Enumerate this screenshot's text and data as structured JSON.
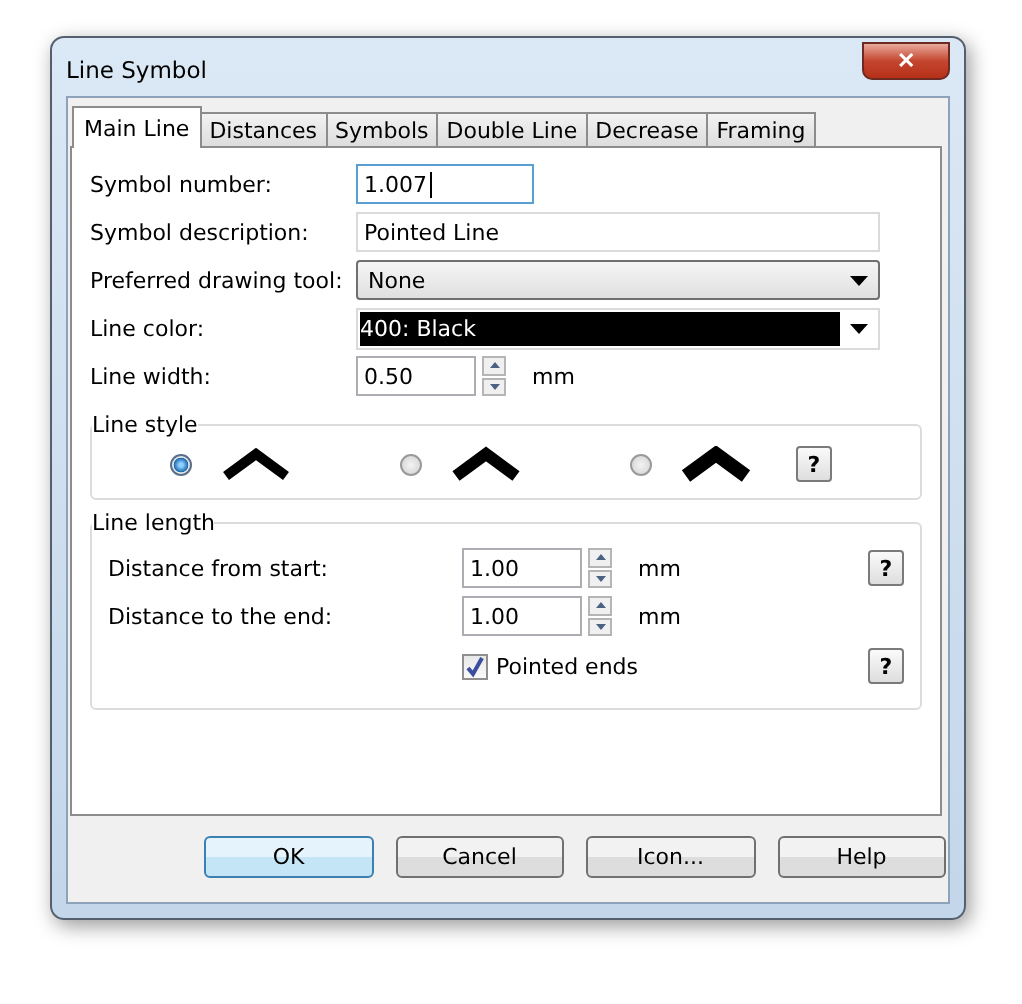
{
  "window": {
    "title": "Line Symbol",
    "close": "✕"
  },
  "tabs": [
    {
      "label": "Main Line",
      "selected": true
    },
    {
      "label": "Distances",
      "selected": false
    },
    {
      "label": "Symbols",
      "selected": false
    },
    {
      "label": "Double Line",
      "selected": false
    },
    {
      "label": "Decrease",
      "selected": false
    },
    {
      "label": "Framing",
      "selected": false
    }
  ],
  "fields": [
    {
      "kind": "text",
      "label": "Symbol number:",
      "value": "1.007",
      "focused": true
    },
    {
      "kind": "text",
      "label": "Symbol description:",
      "value": "Pointed Line",
      "focused": false
    },
    {
      "kind": "dropdown",
      "label": "Preferred drawing tool:",
      "value": "None"
    },
    {
      "kind": "color",
      "label": "Line color:",
      "value": "400: Black",
      "color": "#000000"
    },
    {
      "kind": "spin",
      "label": "Line width:",
      "value": "0.50",
      "unit": "mm"
    }
  ],
  "line_style": {
    "title": "Line style",
    "help": "?",
    "options": [
      {
        "selected": true
      },
      {
        "selected": false
      },
      {
        "selected": false
      }
    ]
  },
  "line_length": {
    "title": "Line length",
    "help": "?",
    "rows": [
      {
        "label": "Distance from start:",
        "value": "1.00",
        "unit": "mm"
      },
      {
        "label": "Distance to the end:",
        "value": "1.00",
        "unit": "mm"
      }
    ],
    "pointed_ends": {
      "label": "Pointed ends",
      "checked": true,
      "help": "?"
    }
  },
  "buttons": [
    {
      "label": "OK",
      "default": true
    },
    {
      "label": "Cancel",
      "default": false
    },
    {
      "label": "Icon...",
      "default": false
    },
    {
      "label": "Help",
      "default": false
    }
  ]
}
